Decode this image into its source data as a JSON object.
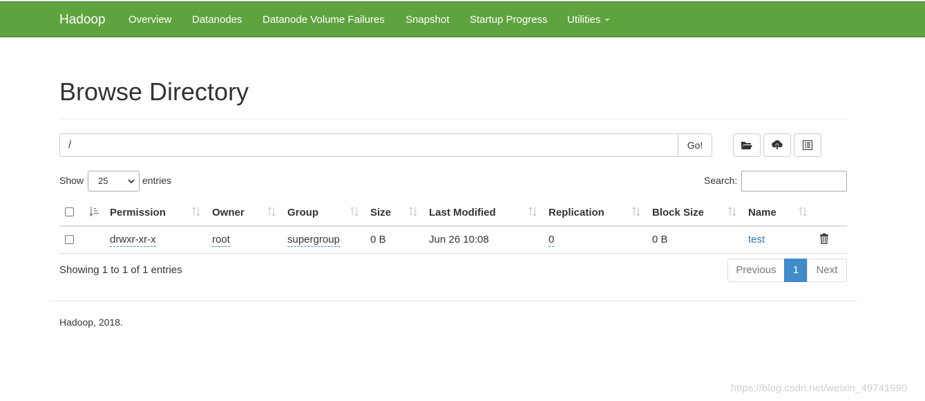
{
  "navbar": {
    "brand": "Hadoop",
    "items": [
      "Overview",
      "Datanodes",
      "Datanode Volume Failures",
      "Snapshot",
      "Startup Progress",
      "Utilities"
    ],
    "bg_color": "#5fa33e"
  },
  "page_title": "Browse Directory",
  "path": {
    "value": "/",
    "go_label": "Go!",
    "buttons": [
      "folder-open-icon",
      "cloud-upload-icon",
      "list-alt-icon"
    ]
  },
  "table_controls": {
    "show_label": "Show",
    "entries_value": "25",
    "entries_label": "entries",
    "search_label": "Search:"
  },
  "table": {
    "columns": [
      "Permission",
      "Owner",
      "Group",
      "Size",
      "Last Modified",
      "Replication",
      "Block Size",
      "Name"
    ],
    "rows": [
      {
        "permission": "drwxr-xr-x",
        "owner": "root",
        "group": "supergroup",
        "size": "0 B",
        "last_modified": "Jun 26 10:08",
        "replication": "0",
        "block_size": "0 B",
        "name": "test"
      }
    ]
  },
  "info": "Showing 1 to 1 of 1 entries",
  "pagination": {
    "previous": "Previous",
    "current": "1",
    "next": "Next",
    "active_color": "#428bca"
  },
  "footer": "Hadoop, 2018.",
  "watermark": "https://blog.csdn.net/weixin_49741990"
}
